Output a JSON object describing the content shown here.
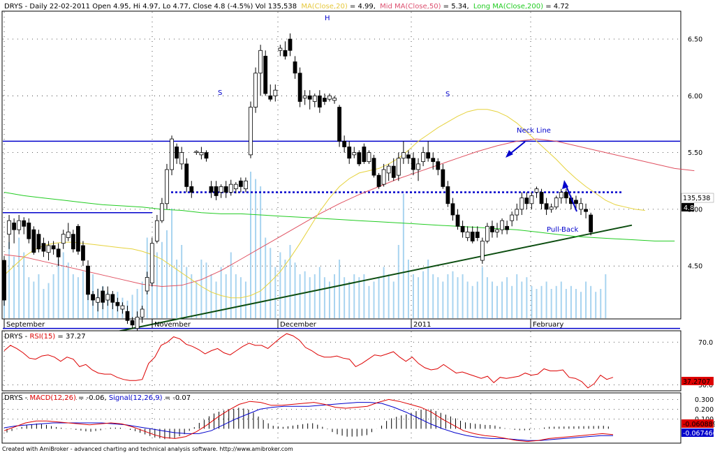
{
  "header": {
    "main_line": "DRYS - Daily 22-02-2011 Open 4.95, Hi 4.97, Lo 4.77, Close 4.8 (-4.5%) Vol 135,538",
    "ma20_label": "MA(Close,20)",
    "ma20_value": " = 4.99,",
    "ma50_label": "Mid MA(Close,50)",
    "ma50_value": " = 5.34,",
    "ma200_label": "Long MA(Close,200)",
    "ma200_value": " = 4.72",
    "rsi_prefix": "DRYS - ",
    "rsi_label": "RSI(15)",
    "rsi_value": " = 37.27",
    "macd_prefix": "DRYS - ",
    "macd_label": "MACD(12,26)",
    "macd_value": " = -0.06, ",
    "signal_label": "Signal(12,26,9)",
    "signal_value": " = -0.07"
  },
  "footer": {
    "credit": "Created with AmiBroker - advanced charting and technical analysis software. http://www.amibroker.com"
  },
  "colors": {
    "candle_up": "#ffffff",
    "candle_down": "#000000",
    "ma20": "#e6d23c",
    "ma50": "#e05060",
    "ma200": "#22cc22",
    "volume": "#a8d4f0",
    "trendline": "#0c4d10",
    "levels": "#0000cc",
    "rsi": "#dd0000",
    "macd": "#dd0000",
    "signal": "#0000cc"
  },
  "chart_data": [
    {
      "type": "candlestick",
      "ylim": [
        4.04,
        6.74
      ],
      "yticks": [
        4.5,
        5.0,
        5.5,
        6.0,
        6.5
      ],
      "x_labels": [
        "September",
        "November",
        "December",
        "2011",
        "February"
      ],
      "candles": [
        [
          4.55,
          4.2,
          4.59,
          4.15
        ],
        [
          4.78,
          4.9,
          4.95,
          4.65
        ],
        [
          4.88,
          4.82,
          4.92,
          4.7
        ],
        [
          4.82,
          4.9,
          4.95,
          4.78
        ],
        [
          4.9,
          4.85,
          4.93,
          4.78
        ],
        [
          4.88,
          4.74,
          4.92,
          4.7
        ],
        [
          4.82,
          4.62,
          4.85,
          4.6
        ],
        [
          4.78,
          4.65,
          4.82,
          4.62
        ],
        [
          4.7,
          4.63,
          4.75,
          4.58
        ],
        [
          4.62,
          4.68,
          4.72,
          4.55
        ],
        [
          4.68,
          4.65,
          4.72,
          4.6
        ],
        [
          4.65,
          4.58,
          4.7,
          4.5
        ],
        [
          4.7,
          4.78,
          4.82,
          4.65
        ],
        [
          4.75,
          4.8,
          4.88,
          4.72
        ],
        [
          4.78,
          4.65,
          4.82,
          4.62
        ],
        [
          4.85,
          4.63,
          4.87,
          4.6
        ],
        [
          4.68,
          4.55,
          4.72,
          4.5
        ],
        [
          4.5,
          4.25,
          4.55,
          4.2
        ],
        [
          4.25,
          4.2,
          4.28,
          4.15
        ],
        [
          4.18,
          4.22,
          4.3,
          4.1
        ],
        [
          4.28,
          4.18,
          4.32,
          4.12
        ],
        [
          4.2,
          4.25,
          4.32,
          4.15
        ],
        [
          4.25,
          4.18,
          4.28,
          4.12
        ],
        [
          4.18,
          4.15,
          4.22,
          4.1
        ],
        [
          4.12,
          4.15,
          4.18,
          4.08
        ],
        [
          4.1,
          4.02,
          4.15,
          3.99
        ],
        [
          4.02,
          3.98,
          4.05,
          3.95
        ],
        [
          3.95,
          4.05,
          4.1,
          3.93
        ],
        [
          4.05,
          4.12,
          4.15,
          4.0
        ],
        [
          4.28,
          4.4,
          4.45,
          4.25
        ],
        [
          4.35,
          4.7,
          4.75,
          4.32
        ],
        [
          4.72,
          4.9,
          4.95,
          4.7
        ],
        [
          4.9,
          5.05,
          5.1,
          4.88
        ],
        [
          5.05,
          5.35,
          5.4,
          5.0
        ],
        [
          5.35,
          5.62,
          5.65,
          5.3
        ],
        [
          5.55,
          5.45,
          5.58,
          5.4
        ],
        [
          5.4,
          5.5,
          5.55,
          5.35
        ],
        [
          5.4,
          5.2,
          5.45,
          5.15
        ],
        [
          5.2,
          5.15,
          5.25,
          5.1
        ],
        [
          5.5,
          5.51,
          5.52,
          5.48
        ],
        [
          5.48,
          5.5,
          5.55,
          5.44
        ],
        [
          5.5,
          5.45,
          5.52,
          5.42
        ],
        [
          5.2,
          5.15,
          5.25,
          5.1
        ],
        [
          5.2,
          5.12,
          5.25,
          5.08
        ],
        [
          5.15,
          5.2,
          5.22,
          5.1
        ],
        [
          5.2,
          5.15,
          5.25,
          5.1
        ],
        [
          5.15,
          5.22,
          5.26,
          5.12
        ],
        [
          5.18,
          5.22,
          5.24,
          5.14
        ],
        [
          5.25,
          5.2,
          5.28,
          5.15
        ],
        [
          5.18,
          5.25,
          5.28,
          5.15
        ],
        [
          5.48,
          5.9,
          5.95,
          5.45
        ],
        [
          5.9,
          6.2,
          6.25,
          5.85
        ],
        [
          6.2,
          6.4,
          6.45,
          6.0
        ],
        [
          6.35,
          6.02,
          6.4,
          6.0
        ],
        [
          6.0,
          5.97,
          6.1,
          5.95
        ],
        [
          6.0,
          6.05,
          6.1,
          5.95
        ],
        [
          6.4,
          6.42,
          6.45,
          6.35
        ],
        [
          6.4,
          6.35,
          6.48,
          6.32
        ],
        [
          6.5,
          6.4,
          6.55,
          6.35
        ],
        [
          6.3,
          6.2,
          6.35,
          6.15
        ],
        [
          6.2,
          5.95,
          6.25,
          5.9
        ],
        [
          5.98,
          6.0,
          6.05,
          5.92
        ],
        [
          6.0,
          5.97,
          6.05,
          5.88
        ],
        [
          5.95,
          6.0,
          6.02,
          5.9
        ],
        [
          6.0,
          5.9,
          6.05,
          5.85
        ],
        [
          5.98,
          5.95,
          6.02,
          5.92
        ],
        [
          5.97,
          6.0,
          6.02,
          5.95
        ],
        [
          5.96,
          5.98,
          6.0,
          5.93
        ],
        [
          5.9,
          5.6,
          5.92,
          5.55
        ],
        [
          5.6,
          5.55,
          5.65,
          5.5
        ],
        [
          5.55,
          5.45,
          5.6,
          5.4
        ],
        [
          5.48,
          5.5,
          5.55,
          5.45
        ],
        [
          5.5,
          5.4,
          5.52,
          5.38
        ],
        [
          5.55,
          5.42,
          5.58,
          5.4
        ],
        [
          5.42,
          5.5,
          5.52,
          5.4
        ],
        [
          5.45,
          5.3,
          5.48,
          5.28
        ],
        [
          5.3,
          5.2,
          5.32,
          5.18
        ],
        [
          5.22,
          5.35,
          5.4,
          5.2
        ],
        [
          5.32,
          5.38,
          5.4,
          5.25
        ],
        [
          5.38,
          5.28,
          5.45,
          5.25
        ],
        [
          5.3,
          5.45,
          5.5,
          5.25
        ],
        [
          5.45,
          5.5,
          5.6,
          5.4
        ],
        [
          5.48,
          5.45,
          5.52,
          5.4
        ],
        [
          5.45,
          5.35,
          5.5,
          5.3
        ],
        [
          5.35,
          5.4,
          5.45,
          5.25
        ],
        [
          5.42,
          5.5,
          5.55,
          5.38
        ],
        [
          5.5,
          5.45,
          5.6,
          5.42
        ],
        [
          5.45,
          5.42,
          5.5,
          5.35
        ],
        [
          5.42,
          5.35,
          5.45,
          5.3
        ],
        [
          5.35,
          5.2,
          5.4,
          5.18
        ],
        [
          5.2,
          5.05,
          5.25,
          5.02
        ],
        [
          5.05,
          4.95,
          5.1,
          4.9
        ],
        [
          4.95,
          4.85,
          5.0,
          4.82
        ],
        [
          4.85,
          4.8,
          4.9,
          4.75
        ],
        [
          4.75,
          4.8,
          4.85,
          4.72
        ],
        [
          4.8,
          4.72,
          4.85,
          4.7
        ],
        [
          4.8,
          4.75,
          4.85,
          4.72
        ],
        [
          4.55,
          4.72,
          4.75,
          4.52
        ],
        [
          4.72,
          4.85,
          4.88,
          4.7
        ],
        [
          4.85,
          4.8,
          4.9,
          4.75
        ],
        [
          4.8,
          4.82,
          4.88,
          4.75
        ],
        [
          4.82,
          4.9,
          4.92,
          4.78
        ],
        [
          4.85,
          4.82,
          4.9,
          4.78
        ],
        [
          4.9,
          4.95,
          4.98,
          4.85
        ],
        [
          4.95,
          5.0,
          5.05,
          4.9
        ],
        [
          5.0,
          5.1,
          5.15,
          4.95
        ],
        [
          5.1,
          5.05,
          5.15,
          5.0
        ],
        [
          5.05,
          5.12,
          5.15,
          5.0
        ],
        [
          5.15,
          5.18,
          5.2,
          5.1
        ],
        [
          5.15,
          5.05,
          5.18,
          5.0
        ],
        [
          5.05,
          5.0,
          5.1,
          4.95
        ],
        [
          5.0,
          5.02,
          5.05,
          4.97
        ],
        [
          5.02,
          5.1,
          5.12,
          5.0
        ],
        [
          5.1,
          5.15,
          5.18,
          5.05
        ],
        [
          5.15,
          5.1,
          5.18,
          5.05
        ],
        [
          5.1,
          5.05,
          5.12,
          5.0
        ],
        [
          5.08,
          5.05,
          5.12,
          5.0
        ],
        [
          5.0,
          5.05,
          5.1,
          4.95
        ],
        [
          5.0,
          4.98,
          5.05,
          4.92
        ],
        [
          4.95,
          4.8,
          4.97,
          4.77
        ]
      ],
      "ma20": [
        4.42,
        4.5,
        4.58,
        4.64,
        4.68,
        4.7,
        4.71,
        4.71,
        4.7,
        4.69,
        4.68,
        4.67,
        4.66,
        4.65,
        4.63,
        4.6,
        4.56,
        4.5,
        4.44,
        4.38,
        4.32,
        4.27,
        4.24,
        4.22,
        4.22,
        4.24,
        4.28,
        4.36,
        4.45,
        4.57,
        4.7,
        4.84,
        4.98,
        5.1,
        5.2,
        5.27,
        5.32,
        5.34,
        5.36,
        5.4,
        5.45,
        5.52,
        5.6,
        5.66,
        5.72,
        5.77,
        5.82,
        5.86,
        5.88,
        5.88,
        5.86,
        5.82,
        5.76,
        5.68,
        5.6,
        5.52,
        5.44,
        5.35,
        5.27,
        5.2,
        5.14,
        5.08,
        5.04,
        5.02,
        5.0,
        4.99
      ],
      "ma20_step": 2,
      "ma50": [
        4.6,
        4.58,
        4.54,
        4.5,
        4.46,
        4.42,
        4.38,
        4.34,
        4.32,
        4.33,
        4.38,
        4.46,
        4.56,
        4.66,
        4.76,
        4.86,
        4.96,
        5.05,
        5.13,
        5.2,
        5.27,
        5.33,
        5.39,
        5.45,
        5.51,
        5.56,
        5.6,
        5.62,
        5.6,
        5.56,
        5.52,
        5.48,
        5.44,
        5.4,
        5.36,
        5.34
      ],
      "ma50_step": 4,
      "ma200": [
        5.15,
        5.12,
        5.1,
        5.08,
        5.06,
        5.04,
        5.03,
        5.02,
        5.0,
        4.99,
        4.97,
        4.96,
        4.96,
        4.95,
        4.94,
        4.93,
        4.92,
        4.91,
        4.9,
        4.89,
        4.88,
        4.87,
        4.86,
        4.85,
        4.84,
        4.83,
        4.82,
        4.8,
        4.78,
        4.76,
        4.75,
        4.74,
        4.73,
        4.72,
        4.72
      ],
      "ma200_step": 4,
      "volume_relative": [
        0.3,
        0.52,
        0.42,
        0.55,
        0.45,
        0.28,
        0.25,
        0.3,
        0.2,
        0.24,
        0.3,
        0.4,
        0.45,
        0.38,
        0.3,
        0.28,
        0.32,
        0.25,
        0.3,
        0.2,
        0.22,
        0.18,
        0.15,
        0.18,
        0.14,
        0.12,
        0.16,
        0.2,
        0.25,
        0.55,
        0.48,
        0.45,
        0.52,
        0.6,
        0.75,
        0.4,
        0.5,
        0.35,
        0.3,
        0.25,
        0.4,
        0.38,
        0.3,
        0.25,
        0.35,
        0.3,
        0.45,
        0.3,
        0.28,
        0.25,
        1.0,
        0.95,
        0.9,
        0.55,
        0.48,
        0.35,
        0.45,
        0.4,
        0.5,
        0.38,
        0.3,
        0.32,
        0.28,
        0.3,
        0.35,
        0.28,
        0.25,
        0.3,
        0.4,
        0.28,
        0.25,
        0.3,
        0.28,
        0.3,
        0.22,
        0.25,
        0.28,
        0.35,
        0.3,
        0.25,
        0.5,
        0.85,
        0.4,
        0.3,
        0.28,
        0.32,
        0.4,
        0.3,
        0.28,
        0.25,
        0.3,
        0.32,
        0.28,
        0.3,
        0.25,
        0.22,
        0.25,
        0.35,
        0.28,
        0.25,
        0.22,
        0.25,
        0.28,
        0.22,
        0.3,
        0.25,
        0.28,
        0.22,
        0.2,
        0.22,
        0.25,
        0.2,
        0.22,
        0.25,
        0.2,
        0.22,
        0.2,
        0.18,
        0.25,
        0.22,
        0.18,
        0.2,
        0.3
      ],
      "current_volume_label": "135,538",
      "current_price_label": "4.8",
      "annotations": {
        "left_shoulder": "S",
        "head": "H",
        "right_shoulder": "S",
        "neck_line": "Neck Line",
        "pull_back": "Pull-Back"
      },
      "resistance_level": 5.6,
      "neckline_level": 5.15,
      "early_level": 4.97,
      "support_level": 3.95,
      "trendline_start": 3.9,
      "trendline_end": 4.86
    },
    {
      "type": "line",
      "name_label": "RSI(15)",
      "ylim": [
        25,
        80
      ],
      "yticks": [
        30.0,
        70.0
      ],
      "values": [
        62,
        67,
        64,
        60,
        55,
        54,
        57,
        58,
        56,
        52,
        56,
        54,
        47,
        49,
        44,
        41,
        40,
        40,
        37,
        35,
        34,
        34,
        35,
        50,
        56,
        67,
        70,
        75,
        73,
        68,
        66,
        63,
        59,
        62,
        64,
        60,
        58,
        62,
        66,
        69,
        67,
        67,
        64,
        69,
        74,
        78,
        76,
        72,
        65,
        62,
        58,
        56,
        56,
        57,
        55,
        54,
        47,
        50,
        54,
        58,
        57,
        59,
        61,
        56,
        52,
        56,
        50,
        46,
        44,
        45,
        49,
        45,
        41,
        42,
        40,
        38,
        36,
        38,
        32,
        37,
        36,
        37,
        38,
        41,
        39,
        40,
        45,
        43,
        43,
        44,
        37,
        36,
        33,
        27,
        31,
        39,
        35,
        37
      ],
      "current_label": "37.2707"
    },
    {
      "type": "line",
      "ylim": [
        -0.14,
        0.36
      ],
      "yticks": [
        0.3,
        0.2,
        0.1
      ],
      "macd": [
        -0.02,
        0.02,
        0.06,
        0.08,
        0.08,
        0.07,
        0.06,
        0.05,
        0.04,
        0.05,
        0.06,
        0.05,
        0.02,
        -0.02,
        -0.06,
        -0.09,
        -0.1,
        -0.08,
        -0.03,
        0.04,
        0.12,
        0.19,
        0.25,
        0.28,
        0.27,
        0.24,
        0.24,
        0.25,
        0.26,
        0.27,
        0.25,
        0.22,
        0.21,
        0.22,
        0.23,
        0.27,
        0.3,
        0.28,
        0.25,
        0.22,
        0.17,
        0.1,
        0.04,
        -0.02,
        -0.05,
        -0.07,
        -0.08,
        -0.1,
        -0.12,
        -0.13,
        -0.12,
        -0.1,
        -0.09,
        -0.08,
        -0.07,
        -0.06,
        -0.05,
        -0.06
      ],
      "signal": [
        0.01,
        0.03,
        0.04,
        0.05,
        0.06,
        0.06,
        0.06,
        0.06,
        0.06,
        0.05,
        0.04,
        0.02,
        0.0,
        -0.02,
        -0.04,
        -0.05,
        -0.05,
        -0.02,
        0.04,
        0.1,
        0.15,
        0.2,
        0.22,
        0.23,
        0.23,
        0.23,
        0.24,
        0.25,
        0.26,
        0.27,
        0.27,
        0.26,
        0.22,
        0.17,
        0.11,
        0.05,
        0.0,
        -0.04,
        -0.07,
        -0.09,
        -0.1,
        -0.1,
        -0.11,
        -0.12,
        -0.12,
        -0.11,
        -0.1,
        -0.09,
        -0.08,
        -0.07,
        -0.07
      ],
      "macd_current_label": "-0.060889",
      "signal_current_label": "-0.067466"
    }
  ]
}
